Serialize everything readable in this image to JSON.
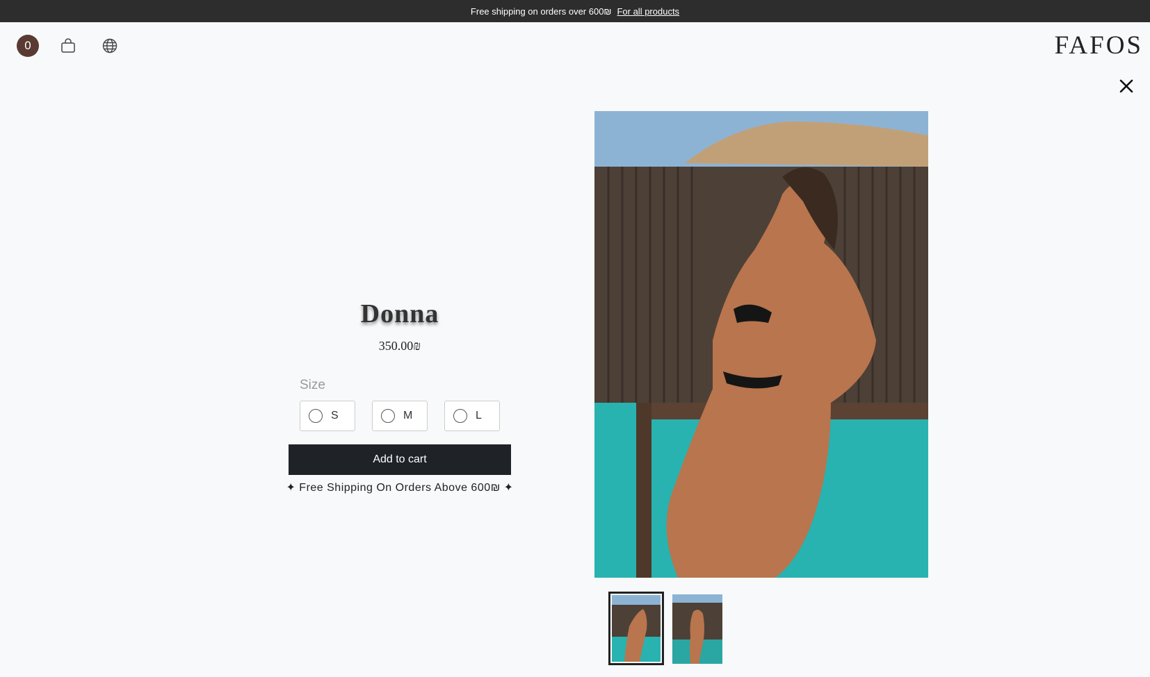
{
  "announcement": {
    "text": "Free shipping on orders over 600₪",
    "link": "For all products"
  },
  "header": {
    "cart_count": "0",
    "logo": "FAFOS"
  },
  "product": {
    "title": "Donna",
    "price": "350.00₪",
    "size_label": "Size",
    "sizes": [
      "S",
      "M",
      "L"
    ],
    "add_to_cart": "Add to cart",
    "shipping_note": "✦ Free Shipping On Orders Above 600₪ ✦"
  },
  "gallery": {
    "thumbnail_count": 2,
    "active_thumbnail": 1
  },
  "icons": [
    "shopping-bag-icon",
    "globe-icon",
    "close-icon"
  ],
  "colors": {
    "announcement_bg": "#2d2d2d",
    "cart_badge": "#5a3a32",
    "button_bg": "#1f2227"
  }
}
